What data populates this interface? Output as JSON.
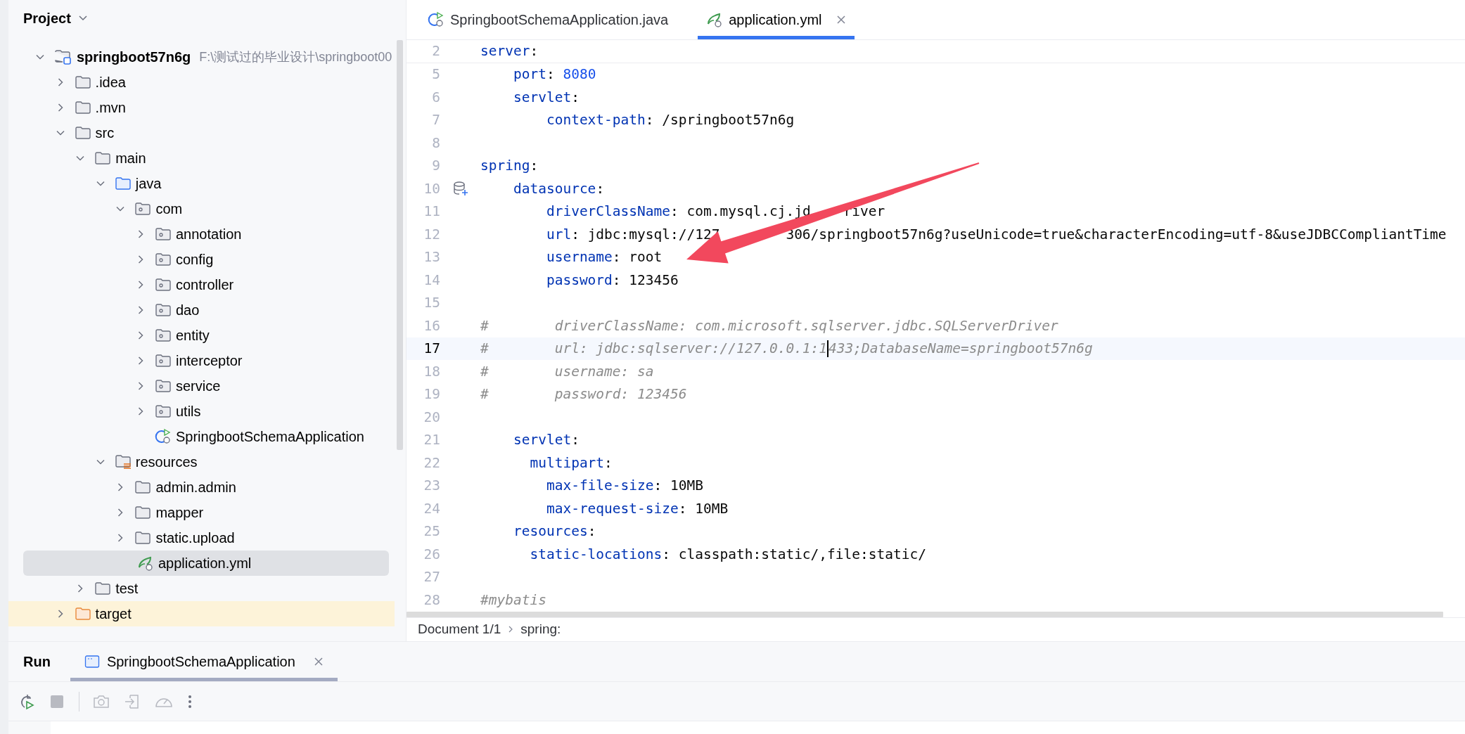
{
  "project_panel": {
    "title": "Project",
    "tree": [
      {
        "label": "springboot57n6g",
        "path": "F:\\测试过的毕业设计\\springboot00",
        "kind": "module",
        "expanded": true,
        "selected": false,
        "children": [
          {
            "label": ".idea",
            "kind": "folder",
            "expanded": false,
            "selected": false
          },
          {
            "label": ".mvn",
            "kind": "folder",
            "expanded": false,
            "selected": false
          },
          {
            "label": "src",
            "kind": "folder",
            "expanded": true,
            "selected": false,
            "children": [
              {
                "label": "main",
                "kind": "folder",
                "expanded": true,
                "selected": false,
                "children": [
                  {
                    "label": "java",
                    "kind": "source-root",
                    "expanded": true,
                    "selected": false,
                    "children": [
                      {
                        "label": "com",
                        "kind": "package",
                        "expanded": true,
                        "selected": false,
                        "children": [
                          {
                            "label": "annotation",
                            "kind": "package",
                            "expanded": false,
                            "selected": false
                          },
                          {
                            "label": "config",
                            "kind": "package",
                            "expanded": false,
                            "selected": false
                          },
                          {
                            "label": "controller",
                            "kind": "package",
                            "expanded": false,
                            "selected": false
                          },
                          {
                            "label": "dao",
                            "kind": "package",
                            "expanded": false,
                            "selected": false
                          },
                          {
                            "label": "entity",
                            "kind": "package",
                            "expanded": false,
                            "selected": false
                          },
                          {
                            "label": "interceptor",
                            "kind": "package",
                            "expanded": false,
                            "selected": false
                          },
                          {
                            "label": "service",
                            "kind": "package",
                            "expanded": false,
                            "selected": false
                          },
                          {
                            "label": "utils",
                            "kind": "package",
                            "expanded": false,
                            "selected": false
                          },
                          {
                            "label": "SpringbootSchemaApplication",
                            "kind": "spring-class",
                            "selected": false
                          }
                        ]
                      }
                    ]
                  },
                  {
                    "label": "resources",
                    "kind": "resource-root",
                    "expanded": true,
                    "selected": false,
                    "children": [
                      {
                        "label": "admin.admin",
                        "kind": "folder",
                        "expanded": false,
                        "selected": false
                      },
                      {
                        "label": "mapper",
                        "kind": "folder",
                        "expanded": false,
                        "selected": false
                      },
                      {
                        "label": "static.upload",
                        "kind": "folder",
                        "expanded": false,
                        "selected": false
                      },
                      {
                        "label": "application.yml",
                        "kind": "yml",
                        "selected": true
                      }
                    ]
                  }
                ]
              },
              {
                "label": "test",
                "kind": "folder",
                "expanded": false,
                "selected": false
              }
            ]
          },
          {
            "label": "target",
            "kind": "excluded",
            "expanded": false,
            "selected": false
          }
        ]
      }
    ]
  },
  "editor": {
    "tabs": [
      {
        "label": "SpringbootSchemaApplication.java",
        "kind": "spring-class",
        "selected": false,
        "closable": false
      },
      {
        "label": "application.yml",
        "kind": "yml",
        "selected": true,
        "closable": true
      }
    ],
    "lines": [
      {
        "number": "2",
        "current": false,
        "tokens": [
          {
            "kind": "key",
            "text": "server"
          },
          {
            "kind": "punct",
            "text": ":"
          }
        ]
      },
      {
        "number": "5",
        "current": false,
        "tokens": [
          {
            "kind": "key",
            "text": "    port"
          },
          {
            "kind": "punct",
            "text": ": "
          },
          {
            "kind": "num",
            "text": "8080"
          }
        ]
      },
      {
        "number": "6",
        "current": false,
        "tokens": [
          {
            "kind": "key",
            "text": "    servlet"
          },
          {
            "kind": "punct",
            "text": ":"
          }
        ]
      },
      {
        "number": "7",
        "current": false,
        "tokens": [
          {
            "kind": "key",
            "text": "        context-path"
          },
          {
            "kind": "punct",
            "text": ": "
          },
          {
            "kind": "plain",
            "text": "/springboot57n6g"
          }
        ]
      },
      {
        "number": "8",
        "current": false
      },
      {
        "number": "9",
        "current": false,
        "tokens": [
          {
            "kind": "key",
            "text": "spring"
          },
          {
            "kind": "punct",
            "text": ":"
          }
        ]
      },
      {
        "number": "10",
        "current": false,
        "gutter_icon": true,
        "tokens": [
          {
            "kind": "key",
            "text": "    datasource"
          },
          {
            "kind": "punct",
            "text": ":"
          }
        ]
      },
      {
        "number": "11",
        "current": false,
        "tokens": [
          {
            "kind": "key",
            "text": "        driverClassName"
          },
          {
            "kind": "punct",
            "text": ": "
          },
          {
            "kind": "plain",
            "text": "com.mysql.cj.jd"
          },
          {
            "kind": "plain",
            "text": "    river"
          }
        ]
      },
      {
        "number": "12",
        "current": false,
        "tokens": [
          {
            "kind": "key",
            "text": "        url"
          },
          {
            "kind": "punct",
            "text": ": "
          },
          {
            "kind": "plain",
            "text": "jdbc:mysql://127"
          },
          {
            "kind": "plain",
            "text": "        306/springboot57n6g?useUnicode=true&characterEncoding=utf-8&useJDBCCompliantTime"
          }
        ]
      },
      {
        "number": "13",
        "current": false,
        "tokens": [
          {
            "kind": "key",
            "text": "        username"
          },
          {
            "kind": "punct",
            "text": ": "
          },
          {
            "kind": "plain",
            "text": "root"
          }
        ]
      },
      {
        "number": "14",
        "current": false,
        "tokens": [
          {
            "kind": "key",
            "text": "        password"
          },
          {
            "kind": "punct",
            "text": ": "
          },
          {
            "kind": "plain",
            "text": "123456"
          }
        ]
      },
      {
        "number": "15",
        "current": false
      },
      {
        "number": "16",
        "current": false,
        "tokens": [
          {
            "kind": "comment",
            "text": "#        driverClassName: com.microsoft.sqlserver.jdbc.SQLServerDriver"
          }
        ]
      },
      {
        "number": "17",
        "current": true,
        "tokens": [
          {
            "kind": "comment",
            "text": "#        url: jdbc:sqlserver://127.0.0.1:1"
          },
          {
            "kind": "caret"
          },
          {
            "kind": "comment",
            "text": "433;DatabaseName=springboot57n6g"
          }
        ]
      },
      {
        "number": "18",
        "current": false,
        "tokens": [
          {
            "kind": "comment",
            "text": "#        username: sa"
          }
        ]
      },
      {
        "number": "19",
        "current": false,
        "tokens": [
          {
            "kind": "comment",
            "text": "#        password: 123456"
          }
        ]
      },
      {
        "number": "20",
        "current": false
      },
      {
        "number": "21",
        "current": false,
        "tokens": [
          {
            "kind": "key",
            "text": "    servlet"
          },
          {
            "kind": "punct",
            "text": ":"
          }
        ]
      },
      {
        "number": "22",
        "current": false,
        "tokens": [
          {
            "kind": "key",
            "text": "      multipart"
          },
          {
            "kind": "punct",
            "text": ":"
          }
        ]
      },
      {
        "number": "23",
        "current": false,
        "tokens": [
          {
            "kind": "key",
            "text": "        max-file-size"
          },
          {
            "kind": "punct",
            "text": ": "
          },
          {
            "kind": "plain",
            "text": "10MB"
          }
        ]
      },
      {
        "number": "24",
        "current": false,
        "tokens": [
          {
            "kind": "key",
            "text": "        max-request-size"
          },
          {
            "kind": "punct",
            "text": ": "
          },
          {
            "kind": "plain",
            "text": "10MB"
          }
        ]
      },
      {
        "number": "25",
        "current": false,
        "tokens": [
          {
            "kind": "key",
            "text": "    resources"
          },
          {
            "kind": "punct",
            "text": ":"
          }
        ]
      },
      {
        "number": "26",
        "current": false,
        "tokens": [
          {
            "kind": "key",
            "text": "      static-locations"
          },
          {
            "kind": "punct",
            "text": ": "
          },
          {
            "kind": "plain",
            "text": "classpath:static/,file:static/"
          }
        ]
      },
      {
        "number": "27",
        "current": false
      },
      {
        "number": "28",
        "current": false,
        "tokens": [
          {
            "kind": "comment",
            "text": "#mybatis"
          }
        ]
      }
    ],
    "breadcrumb": [
      "Document 1/1",
      "spring:"
    ]
  },
  "run_panel": {
    "title": "Run",
    "tabs": [
      {
        "label": "SpringbootSchemaApplication",
        "selected": true
      }
    ],
    "toolbar": [
      {
        "kind": "rerun",
        "disabled": false
      },
      {
        "kind": "stop",
        "disabled": true
      },
      {
        "kind": "separator"
      },
      {
        "kind": "camera",
        "disabled": true
      },
      {
        "kind": "exit",
        "disabled": true
      },
      {
        "kind": "gauge",
        "disabled": true
      },
      {
        "kind": "more",
        "disabled": false
      }
    ]
  },
  "annotation": {
    "kind": "arrow"
  }
}
